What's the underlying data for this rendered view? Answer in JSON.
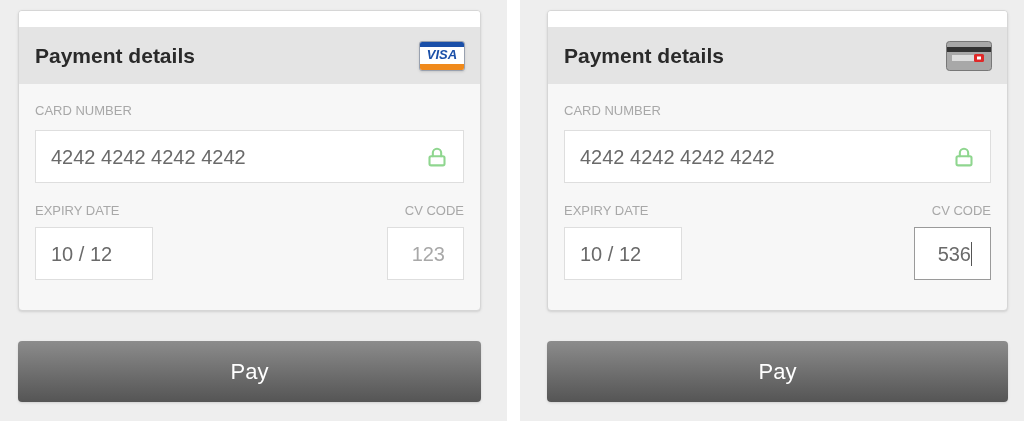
{
  "panels": [
    {
      "title": "Payment details",
      "card_icon": {
        "kind": "visa",
        "text": "VISA"
      },
      "card_number": {
        "label": "CARD NUMBER",
        "value": "4242 4242 4242 4242",
        "secure": true
      },
      "expiry": {
        "label": "EXPIRY DATE",
        "value": "10 / 12"
      },
      "cv_code": {
        "label": "CV CODE",
        "placeholder": "123",
        "focused": false
      },
      "button": "Pay"
    },
    {
      "title": "Payment details",
      "card_icon": {
        "kind": "back"
      },
      "card_number": {
        "label": "CARD NUMBER",
        "value": "4242 4242 4242 4242",
        "secure": true
      },
      "expiry": {
        "label": "EXPIRY DATE",
        "value": "10 / 12"
      },
      "cv_code": {
        "label": "CV CODE",
        "value": "536",
        "focused": true
      },
      "button": "Pay"
    }
  ]
}
